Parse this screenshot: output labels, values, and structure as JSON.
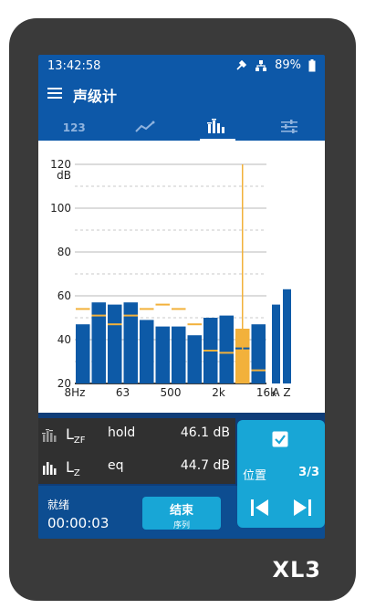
{
  "status": {
    "time": "13:42:58",
    "battery": "89%"
  },
  "app": {
    "title": "声级计"
  },
  "tabs": [
    {
      "label": "123",
      "icon": "numeric-view-icon",
      "active": false
    },
    {
      "label": "",
      "icon": "trend-line-icon",
      "active": false
    },
    {
      "label": "",
      "icon": "spectrum-bars-icon",
      "active": true
    },
    {
      "label": "",
      "icon": "settings-sliders-icon",
      "active": false
    }
  ],
  "readings": [
    {
      "param_main": "L",
      "param_sub": "ZF",
      "mode": "hold",
      "value": "46.1 dB",
      "icon": "spectrum-hold-icon"
    },
    {
      "param_main": "L",
      "param_sub": "Z",
      "mode": "eq",
      "value": "44.7 dB",
      "icon": "spectrum-eq-icon"
    }
  ],
  "bottom": {
    "state": "就绪",
    "elapsed": "00:00:03",
    "stop_label": "结束",
    "stop_sub": "序列"
  },
  "position": {
    "label": "位置",
    "count": "3/3"
  },
  "device": {
    "brand": "XL3"
  },
  "colors": {
    "bar": "#0d5aa7",
    "highlight_bar": "#f2b13b",
    "hold_line": "#f2b13b",
    "screen_bg": "#0f3d78"
  },
  "chart_data": {
    "type": "bar",
    "ylabel": "dB",
    "ylim": [
      20,
      120
    ],
    "y_ticks": [
      "20",
      "40",
      "60",
      "80",
      "100",
      "120"
    ],
    "x_tick_labels": [
      "8Hz",
      "63",
      "500",
      "2k",
      "16k"
    ],
    "bands": [
      {
        "eq": 47,
        "hold": 54
      },
      {
        "eq": 57,
        "hold": 51
      },
      {
        "eq": 56,
        "hold": 47
      },
      {
        "eq": 57,
        "hold": 51
      },
      {
        "eq": 49,
        "hold": 54
      },
      {
        "eq": 46,
        "hold": 56
      },
      {
        "eq": 46,
        "hold": 54
      },
      {
        "eq": 42,
        "hold": 47
      },
      {
        "eq": 50,
        "hold": 35
      },
      {
        "eq": 51,
        "hold": 34
      },
      {
        "eq": 45,
        "hold": 36
      },
      {
        "eq": 47,
        "hold": 26
      }
    ],
    "selected_band_index": 10,
    "overall_labels": [
      "A",
      "Z"
    ],
    "overall_values": [
      56,
      63
    ]
  }
}
